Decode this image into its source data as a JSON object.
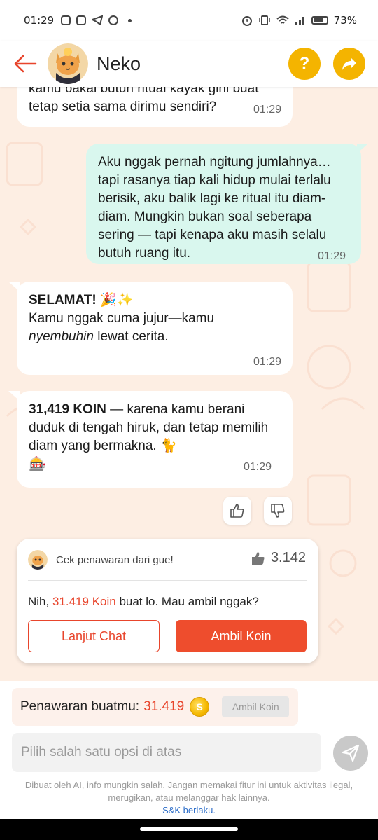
{
  "status_bar": {
    "time": "01:29",
    "battery": "73%"
  },
  "header": {
    "title": "Neko"
  },
  "messages": [
    {
      "direction": "in",
      "lines": [
        "kamu bakal butuh ritual kayak gini buat",
        "tetap setia sama dirimu sendiri?"
      ],
      "time": "01:29"
    },
    {
      "direction": "out",
      "text": "Aku nggak pernah ngitung jumlahnya… tapi rasanya tiap kali hidup mulai terlalu berisik, aku balik lagi ke ritual itu diam-diam. Mungkin bukan soal seberapa sering — tapi kenapa aku masih selalu butuh ruang itu.",
      "time": "01:29"
    },
    {
      "direction": "in",
      "bold": "SELAMAT!",
      "emoji": "🎉✨",
      "line2": "Kamu nggak cuma jujur—kamu",
      "italic": "nyembuhin",
      "rest": " lewat cerita.",
      "time": "01:29"
    },
    {
      "direction": "in",
      "bold": "31,419 KOIN",
      "text": " — karena kamu berani duduk di tengah hiruk, dan tetap memilih diam yang bermakna. 🐈",
      "emoji2": "🎰",
      "time": "01:29"
    }
  ],
  "offer_card": {
    "header": "Cek penawaran dari gue!",
    "rating": "3.142",
    "message_prefix": "Nih, ",
    "message_highlight": "31.419 Koin",
    "message_suffix": " buat lo. Mau ambil nggak?",
    "continue_label": "Lanjut Chat",
    "take_label": "Ambil Koin"
  },
  "offer_strip": {
    "label": "Penawaran buatmu:",
    "value": "31.419",
    "coin_glyph": "S",
    "button": "Ambil Koin"
  },
  "input": {
    "placeholder": "Pilih salah satu opsi di atas"
  },
  "disclaimer": {
    "text": "Dibuat oleh AI, info mungkin salah. Jangan memakai fitur ini untuk aktivitas ilegal, merugikan, atau melanggar hak lainnya.",
    "link": "S&K berlaku."
  },
  "colors": {
    "accent": "#ee4d2d",
    "header_button": "#f4b400",
    "outgoing_bubble": "#d9f7ee",
    "chat_background": "#fdeee3"
  },
  "icons": {
    "back": "arrow-left-icon",
    "help": "question-icon",
    "share": "share-arrow-icon",
    "like": "thumbs-up-icon",
    "dislike": "thumbs-down-icon",
    "send": "send-icon"
  }
}
